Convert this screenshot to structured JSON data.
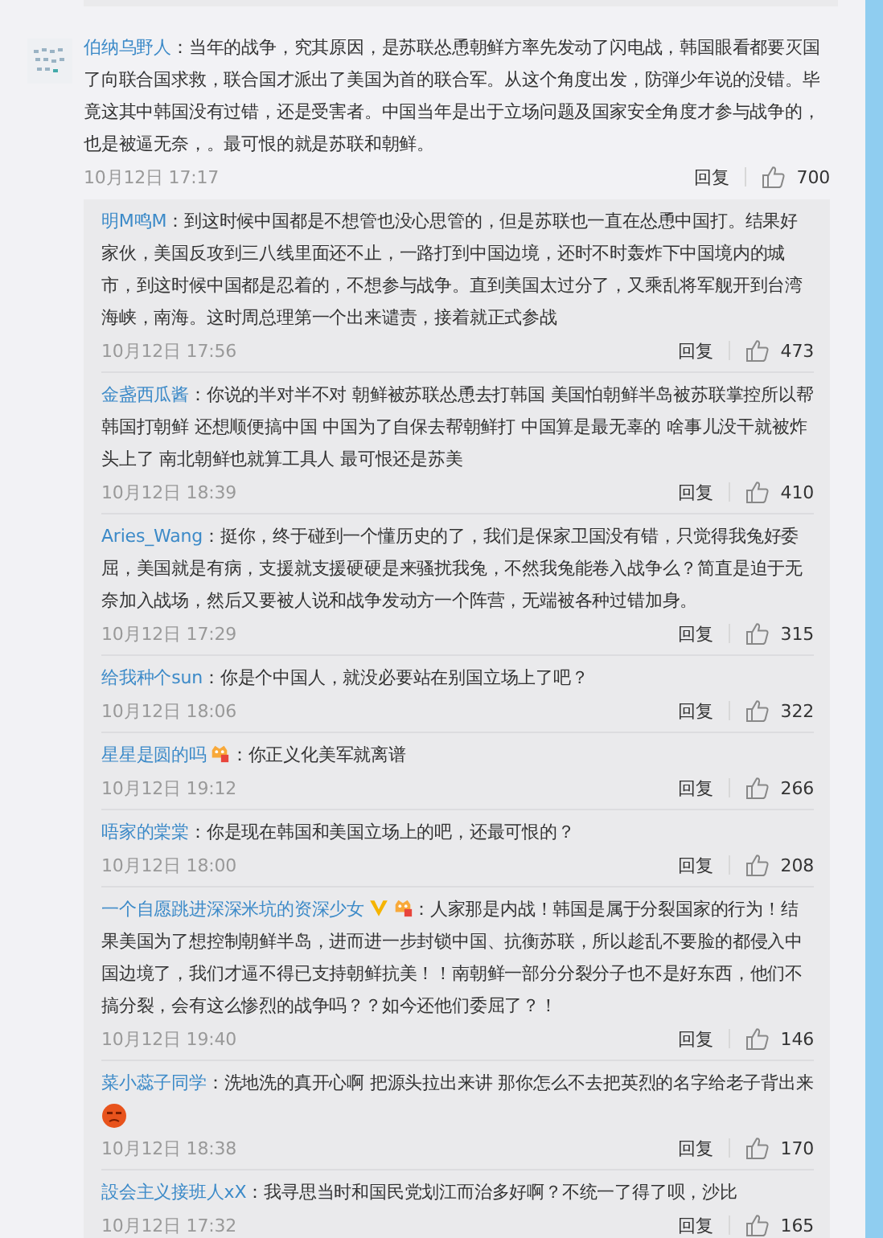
{
  "comment": {
    "author": "伯纳乌野人",
    "text": "：当年的战争，究其原因，是苏联怂恿朝鲜方率先发动了闪电战，韩国眼看都要灭国了向联合国求救，联合国才派出了美国为首的联合军。从这个角度出发，防弾少年说的没错。毕竟这其中韩国没有过错，还是受害者。中国当年是出于立场问题及国家安全角度才参与战争的，也是被逼无奈，。最可恨的就是苏联和朝鲜。",
    "time": "10月12日 17:17",
    "reply_label": "回复",
    "likes": "700",
    "replies": [
      {
        "author": "明M鸣M",
        "verified": false,
        "member_badge": false,
        "emoticon": false,
        "text": "：到这时候中国都是不想管也没心思管的，但是苏联也一直在怂恿中国打。结果好家伙，美国反攻到三八线里面还不止，一路打到中国边境，还时不时轰炸下中国境内的城市，到这时候中国都是忍着的，不想参与战争。直到美国太过分了，又乘乱将军舰开到台湾海峡，南海。这时周总理第一个出来谴责，接着就正式参战",
        "time": "10月12日 17:56",
        "reply_label": "回复",
        "likes": "473"
      },
      {
        "author": "金盏西瓜酱",
        "verified": false,
        "member_badge": false,
        "emoticon": false,
        "text": "：你说的半对半不对 朝鲜被苏联怂恿去打韩国 美国怕朝鲜半岛被苏联掌控所以帮韩国打朝鲜 还想顺便搞中国 中国为了自保去帮朝鲜打 中国算是最无辜的 啥事儿没干就被炸头上了 南北朝鲜也就算工具人 最可恨还是苏美",
        "time": "10月12日 18:39",
        "reply_label": "回复",
        "likes": "410"
      },
      {
        "author": "Aries_Wang",
        "verified": false,
        "member_badge": false,
        "emoticon": false,
        "text": "：挺你，终于碰到一个懂历史的了，我们是保家卫国没有错，只觉得我兔好委屈，美国就是有病，支援就支援硬硬是来骚扰我兔，不然我兔能卷入战争么？简直是迫于无奈加入战场，然后又要被人说和战争发动方一个阵营，无端被各种过错加身。",
        "time": "10月12日 17:29",
        "reply_label": "回复",
        "likes": "315"
      },
      {
        "author": "给我种个sun",
        "verified": false,
        "member_badge": false,
        "emoticon": false,
        "text": "：你是个中国人，就没必要站在别国立场上了吧？",
        "time": "10月12日 18:06",
        "reply_label": "回复",
        "likes": "322"
      },
      {
        "author": "星星是圆的吗",
        "verified": false,
        "member_badge": true,
        "emoticon": false,
        "text": "：你正义化美军就离谱",
        "time": "10月12日 19:12",
        "reply_label": "回复",
        "likes": "266"
      },
      {
        "author": "唔家的棠棠",
        "verified": false,
        "member_badge": false,
        "emoticon": false,
        "text": "：你是现在韩国和美国立场上的吧，还最可恨的？",
        "time": "10月12日 18:00",
        "reply_label": "回复",
        "likes": "208"
      },
      {
        "author": "一个自愿跳进深深米坑的资深少女",
        "verified": true,
        "member_badge": true,
        "emoticon": false,
        "text": "：人家那是内战！韩国是属于分裂国家的行为！结果美国为了想控制朝鲜半岛，进而进一步封锁中国、抗衡苏联，所以趁乱不要脸的都侵入中国边境了，我们才逼不得已支持朝鲜抗美！！南朝鲜一部分分裂分子也不是好东西，他们不搞分裂，会有这么惨烈的战争吗？？如今还他们委屈了？！",
        "time": "10月12日 19:40",
        "reply_label": "回复",
        "likes": "146"
      },
      {
        "author": "菜小蕊子同学",
        "verified": false,
        "member_badge": false,
        "emoticon": true,
        "text": "：洗地洗的真开心啊 把源头拉出来讲 那你怎么不去把英烈的名字给老子背出来",
        "time": "10月12日 18:38",
        "reply_label": "回复",
        "likes": "170"
      },
      {
        "author": "設会主义接班人xX",
        "verified": false,
        "member_badge": false,
        "emoticon": false,
        "text": "：我寻思当时和国民党划江而治多好啊？不统一了得了呗，沙比",
        "time": "10月12日 17:32",
        "reply_label": "回复",
        "likes": "165"
      }
    ]
  }
}
